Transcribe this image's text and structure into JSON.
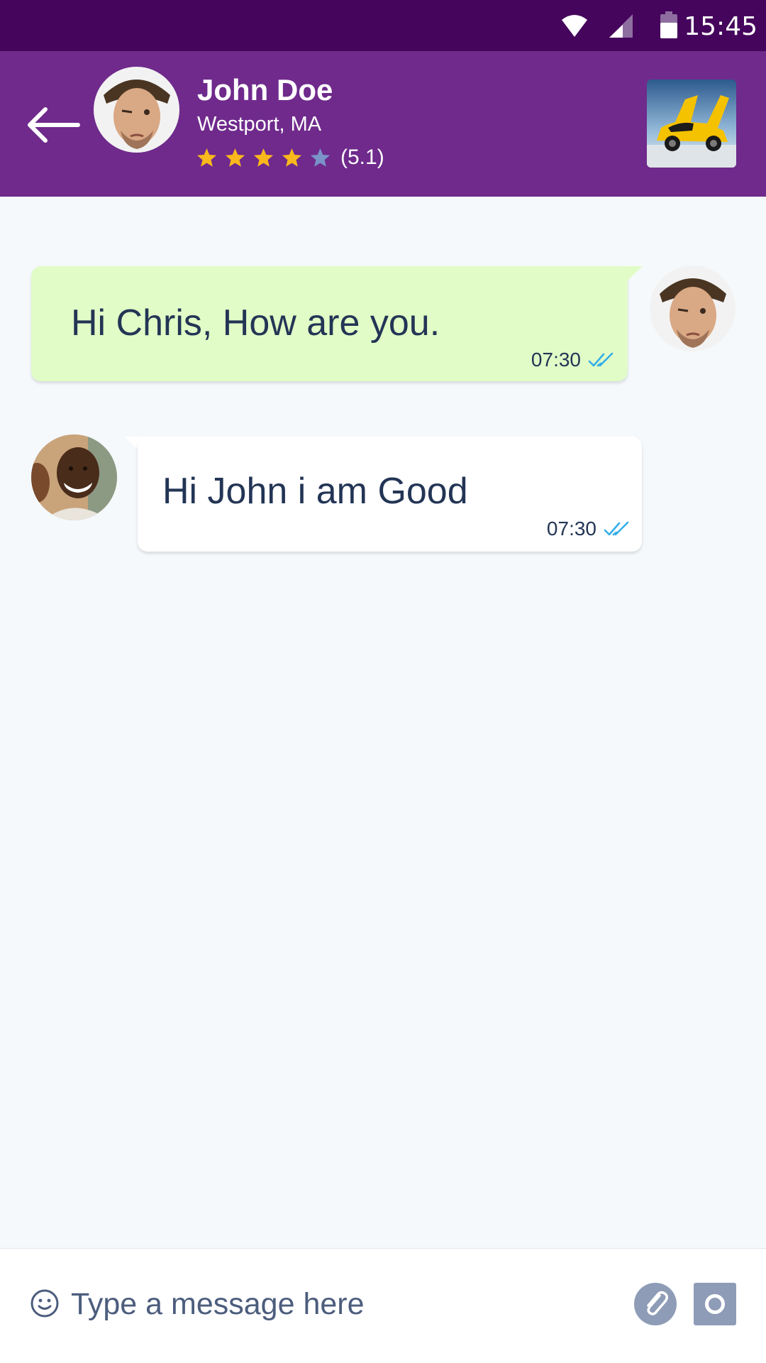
{
  "status_bar": {
    "time": "15:45",
    "icons": [
      "wifi-icon",
      "cell-signal-icon",
      "battery-icon"
    ]
  },
  "header": {
    "back_icon": "arrow-left-icon",
    "contact_name": "John Doe",
    "location": "Westport, MA",
    "stars_filled": 4,
    "stars_total": 5,
    "rating_text": "(5.1)",
    "thumbnail": "yellow-sports-car-thumbnail"
  },
  "messages": [
    {
      "direction": "outgoing",
      "text": "Hi Chris, How are you.",
      "time": "07:30",
      "status_icon": "double-check-icon",
      "avatar": "john-doe-avatar"
    },
    {
      "direction": "incoming",
      "text": "Hi John i am Good",
      "time": "07:30",
      "status_icon": "double-check-icon",
      "avatar": "chris-avatar"
    }
  ],
  "composer": {
    "placeholder": "Type a message here",
    "emoji_icon": "smiley-icon",
    "attach_icon": "paperclip-icon",
    "camera_icon": "camera-icon"
  },
  "colors": {
    "status_bar": "#45055c",
    "header": "#6f2a8c",
    "chat_background": "#f5f9fc",
    "outgoing_bubble": "#e1fcc7",
    "incoming_bubble": "#ffffff",
    "message_text": "#233555",
    "read_check": "#35aee8",
    "star_filled": "#f9b81c",
    "star_empty": "#7a93c9",
    "composer_button": "#8e9cb7"
  }
}
